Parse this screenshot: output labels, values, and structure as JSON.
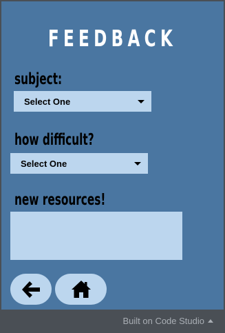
{
  "screen": {
    "title": "FEEDBACK"
  },
  "form": {
    "subject_label": "subject:",
    "subject_value": "Select One",
    "difficulty_label": "how difficult?",
    "difficulty_value": "Select One",
    "resources_label": "new resources!",
    "resources_value": ""
  },
  "nav": {
    "back_icon": "arrow-left-icon",
    "home_icon": "home-icon"
  },
  "footer": {
    "text": "Built on Code Studio"
  },
  "colors": {
    "app_background": "#4a76a1",
    "control_background": "#bcd6ee",
    "frame": "#4a4f55",
    "footer_text": "#a9aeb4"
  }
}
